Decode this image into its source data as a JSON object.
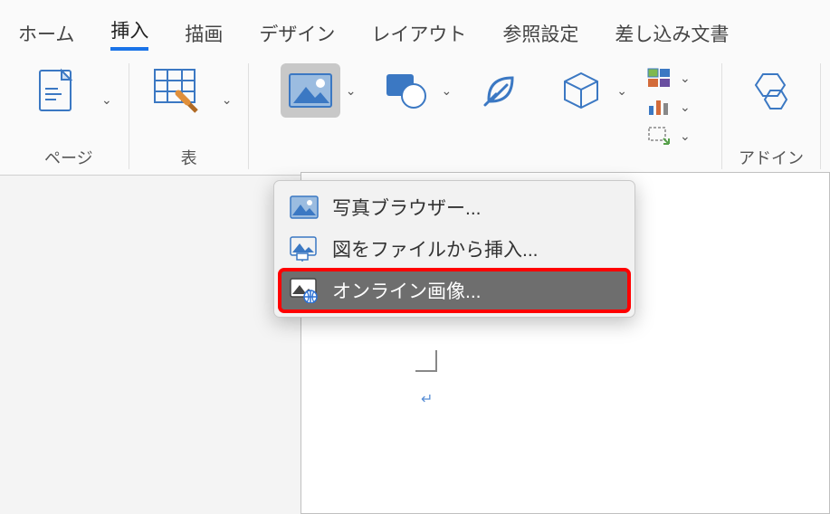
{
  "tabs": {
    "home": "ホーム",
    "insert": "挿入",
    "draw": "描画",
    "design": "デザイン",
    "layout": "レイアウト",
    "references": "参照設定",
    "mailings": "差し込み文書"
  },
  "ribbon": {
    "pages_label": "ページ",
    "table_label": "表",
    "addins_label": "アドイン"
  },
  "dropdown": {
    "photo_browser": "写真ブラウザー...",
    "from_file": "図をファイルから挿入...",
    "online_picture": "オンライン画像..."
  },
  "paragraph_mark": "↵"
}
